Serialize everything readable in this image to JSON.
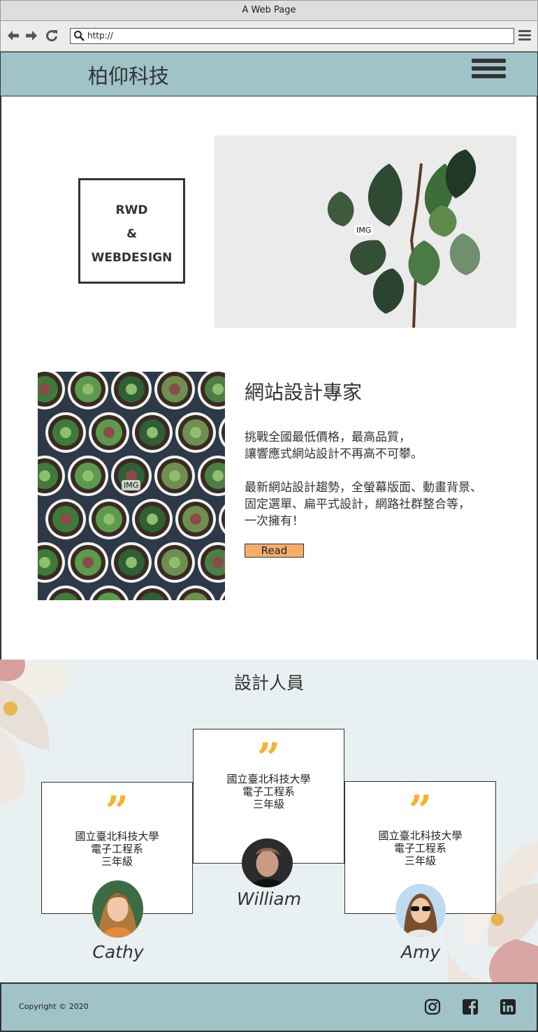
{
  "browser": {
    "title": "A Web Page",
    "url": "http://"
  },
  "header": {
    "brand": "柏仰科技"
  },
  "hero": {
    "box_lines": [
      "RWD",
      "&",
      "WEBDESIGN"
    ],
    "image_label": "IMG"
  },
  "intro": {
    "image_label": "IMG",
    "title": "網站設計專家",
    "paragraph1": [
      "挑戰全國最低價格，最高品質，",
      "讓響應式網站設計不再高不可攀。"
    ],
    "paragraph2": [
      "最新網站設計趨勢，全螢幕版面、動畫背景、",
      "固定選單、扁平式設計，網路社群整合等，",
      "一次擁有！"
    ],
    "read_label": "Read"
  },
  "designers": {
    "title": "設計人員",
    "cards": [
      {
        "quote": "”",
        "school": "國立臺北科技大學",
        "dept": "電子工程系",
        "grade": "三年級",
        "name": "Cathy"
      },
      {
        "quote": "”",
        "school": "國立臺北科技大學",
        "dept": "電子工程系",
        "grade": "三年級",
        "name": "William"
      },
      {
        "quote": "”",
        "school": "國立臺北科技大學",
        "dept": "電子工程系",
        "grade": "三年級",
        "name": "Amy"
      }
    ]
  },
  "footer": {
    "copyright": "Copyright © 2020",
    "social_icons": [
      "instagram-icon",
      "facebook-icon",
      "linkedin-icon"
    ]
  },
  "colors": {
    "header_bg": "#9fc3c9",
    "section_bg": "#e9f0f1",
    "accent_quote": "#f6b22a",
    "button_bg": "#f6ad6b"
  }
}
